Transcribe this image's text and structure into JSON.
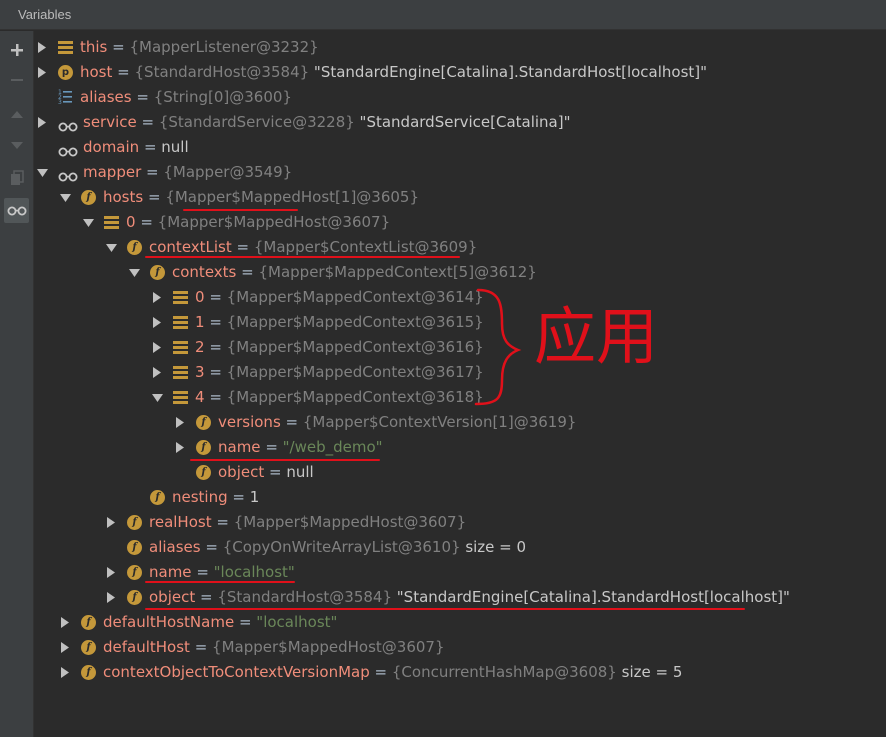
{
  "panel": {
    "title": "Variables"
  },
  "toolbar": {
    "icons": [
      "plus-icon",
      "minus-icon",
      "up-icon",
      "down-icon",
      "copy-icon",
      "watches-icon"
    ]
  },
  "tree": [
    {
      "arrow": "right",
      "icon": "array",
      "name": "this",
      "eq": " = ",
      "type": "{MapperListener@3232}",
      "value": ""
    },
    {
      "arrow": "right",
      "icon": "p",
      "name": "host",
      "eq": " = ",
      "type": "{StandardHost@3584}",
      "value": " \"StandardEngine[Catalina].StandardHost[localhost]\""
    },
    {
      "arrow": "",
      "icon": "num",
      "name": "aliases",
      "eq": " = ",
      "type": "{String[0]@3600}",
      "value": ""
    },
    {
      "arrow": "right",
      "icon": "glasses",
      "name": "service",
      "eq": " = ",
      "type": "{StandardService@3228}",
      "value": " \"StandardService[Catalina]\""
    },
    {
      "arrow": "",
      "icon": "glasses",
      "name": "domain",
      "eq": " = ",
      "type": "",
      "value": "null"
    },
    {
      "arrow": "down",
      "icon": "glasses",
      "name": "mapper",
      "eq": " = ",
      "type": "{Mapper@3549}",
      "value": ""
    },
    {
      "arrow": "down",
      "icon": "f",
      "name": "hosts",
      "eq": " = ",
      "type": "{Mapper$MappedHost[1]@3605}",
      "value": ""
    },
    {
      "arrow": "down",
      "icon": "array",
      "name": "0",
      "eq": " = ",
      "type": "{Mapper$MappedHost@3607}",
      "value": ""
    },
    {
      "arrow": "down",
      "icon": "f",
      "name": "contextList",
      "eq": " = ",
      "type": "{Mapper$ContextList@3609}",
      "value": ""
    },
    {
      "arrow": "down",
      "icon": "f",
      "name": "contexts",
      "eq": " = ",
      "type": "{Mapper$MappedContext[5]@3612}",
      "value": ""
    },
    {
      "arrow": "right",
      "icon": "array",
      "name": "0",
      "eq": " = ",
      "type": "{Mapper$MappedContext@3614}",
      "value": ""
    },
    {
      "arrow": "right",
      "icon": "array",
      "name": "1",
      "eq": " = ",
      "type": "{Mapper$MappedContext@3615}",
      "value": ""
    },
    {
      "arrow": "right",
      "icon": "array",
      "name": "2",
      "eq": " = ",
      "type": "{Mapper$MappedContext@3616}",
      "value": ""
    },
    {
      "arrow": "right",
      "icon": "array",
      "name": "3",
      "eq": " = ",
      "type": "{Mapper$MappedContext@3617}",
      "value": ""
    },
    {
      "arrow": "down",
      "icon": "array",
      "name": "4",
      "eq": " = ",
      "type": "{Mapper$MappedContext@3618}",
      "value": ""
    },
    {
      "arrow": "right",
      "icon": "f",
      "name": "versions",
      "eq": " = ",
      "type": "{Mapper$ContextVersion[1]@3619}",
      "value": ""
    },
    {
      "arrow": "right",
      "icon": "f",
      "name": "name",
      "eq": " = ",
      "type": "",
      "value": "\"/web_demo\"",
      "string": true
    },
    {
      "arrow": "",
      "icon": "f",
      "name": "object",
      "eq": " = ",
      "type": "",
      "value": "null"
    },
    {
      "arrow": "",
      "icon": "f",
      "name": "nesting",
      "eq": " = ",
      "type": "",
      "value": "1"
    },
    {
      "arrow": "right",
      "icon": "f",
      "name": "realHost",
      "eq": " = ",
      "type": "{Mapper$MappedHost@3607}",
      "value": ""
    },
    {
      "arrow": "",
      "icon": "f",
      "name": "aliases",
      "eq": " = ",
      "type": "{CopyOnWriteArrayList@3610}",
      "value": "  size = 0"
    },
    {
      "arrow": "right",
      "icon": "f",
      "name": "name",
      "eq": " = ",
      "type": "",
      "value": "\"localhost\"",
      "string": true
    },
    {
      "arrow": "right",
      "icon": "f",
      "name": "object",
      "eq": " = ",
      "type": "{StandardHost@3584}",
      "value": " \"StandardEngine[Catalina].StandardHost[localhost]\""
    },
    {
      "arrow": "right",
      "icon": "f",
      "name": "defaultHostName",
      "eq": " = ",
      "type": "",
      "value": "\"localhost\"",
      "string": true
    },
    {
      "arrow": "right",
      "icon": "f",
      "name": "defaultHost",
      "eq": " = ",
      "type": "{Mapper$MappedHost@3607}",
      "value": ""
    },
    {
      "arrow": "right",
      "icon": "f",
      "name": "contextObjectToContextVersionMap",
      "eq": " = ",
      "type": "{ConcurrentHashMap@3608}",
      "value": "  size = 5"
    }
  ],
  "annotation": {
    "text": "应用"
  }
}
